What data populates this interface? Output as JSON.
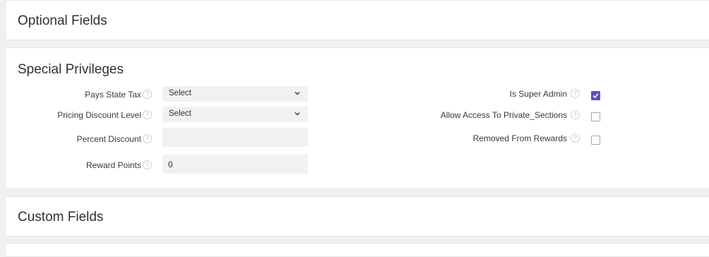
{
  "sections": {
    "optional_fields": {
      "title": "Optional Fields"
    },
    "special_privileges": {
      "title": "Special Privileges",
      "left_fields": [
        {
          "label": "Pays State Tax",
          "type": "select",
          "value": "Select"
        },
        {
          "label": "Pricing Discount Level",
          "type": "select",
          "value": "Select"
        },
        {
          "label": "Percent Discount",
          "type": "text",
          "value": ""
        },
        {
          "label": "Reward Points",
          "type": "text",
          "value": "0"
        }
      ],
      "right_fields": [
        {
          "label": "Is Super Admin",
          "checked": true
        },
        {
          "label": "Allow Access To Private_Sections",
          "checked": false
        },
        {
          "label": "Removed From Rewards",
          "checked": false
        }
      ]
    },
    "custom_fields": {
      "title": "Custom Fields"
    }
  },
  "help_icon": "question-circle-icon",
  "dropdown_icon": "chevron-down-icon",
  "colors": {
    "page_background": "#f0f0f2",
    "card_background": "#ffffff",
    "input_background": "#f1f1f4",
    "checkbox_accent": "#5b4fc4"
  }
}
